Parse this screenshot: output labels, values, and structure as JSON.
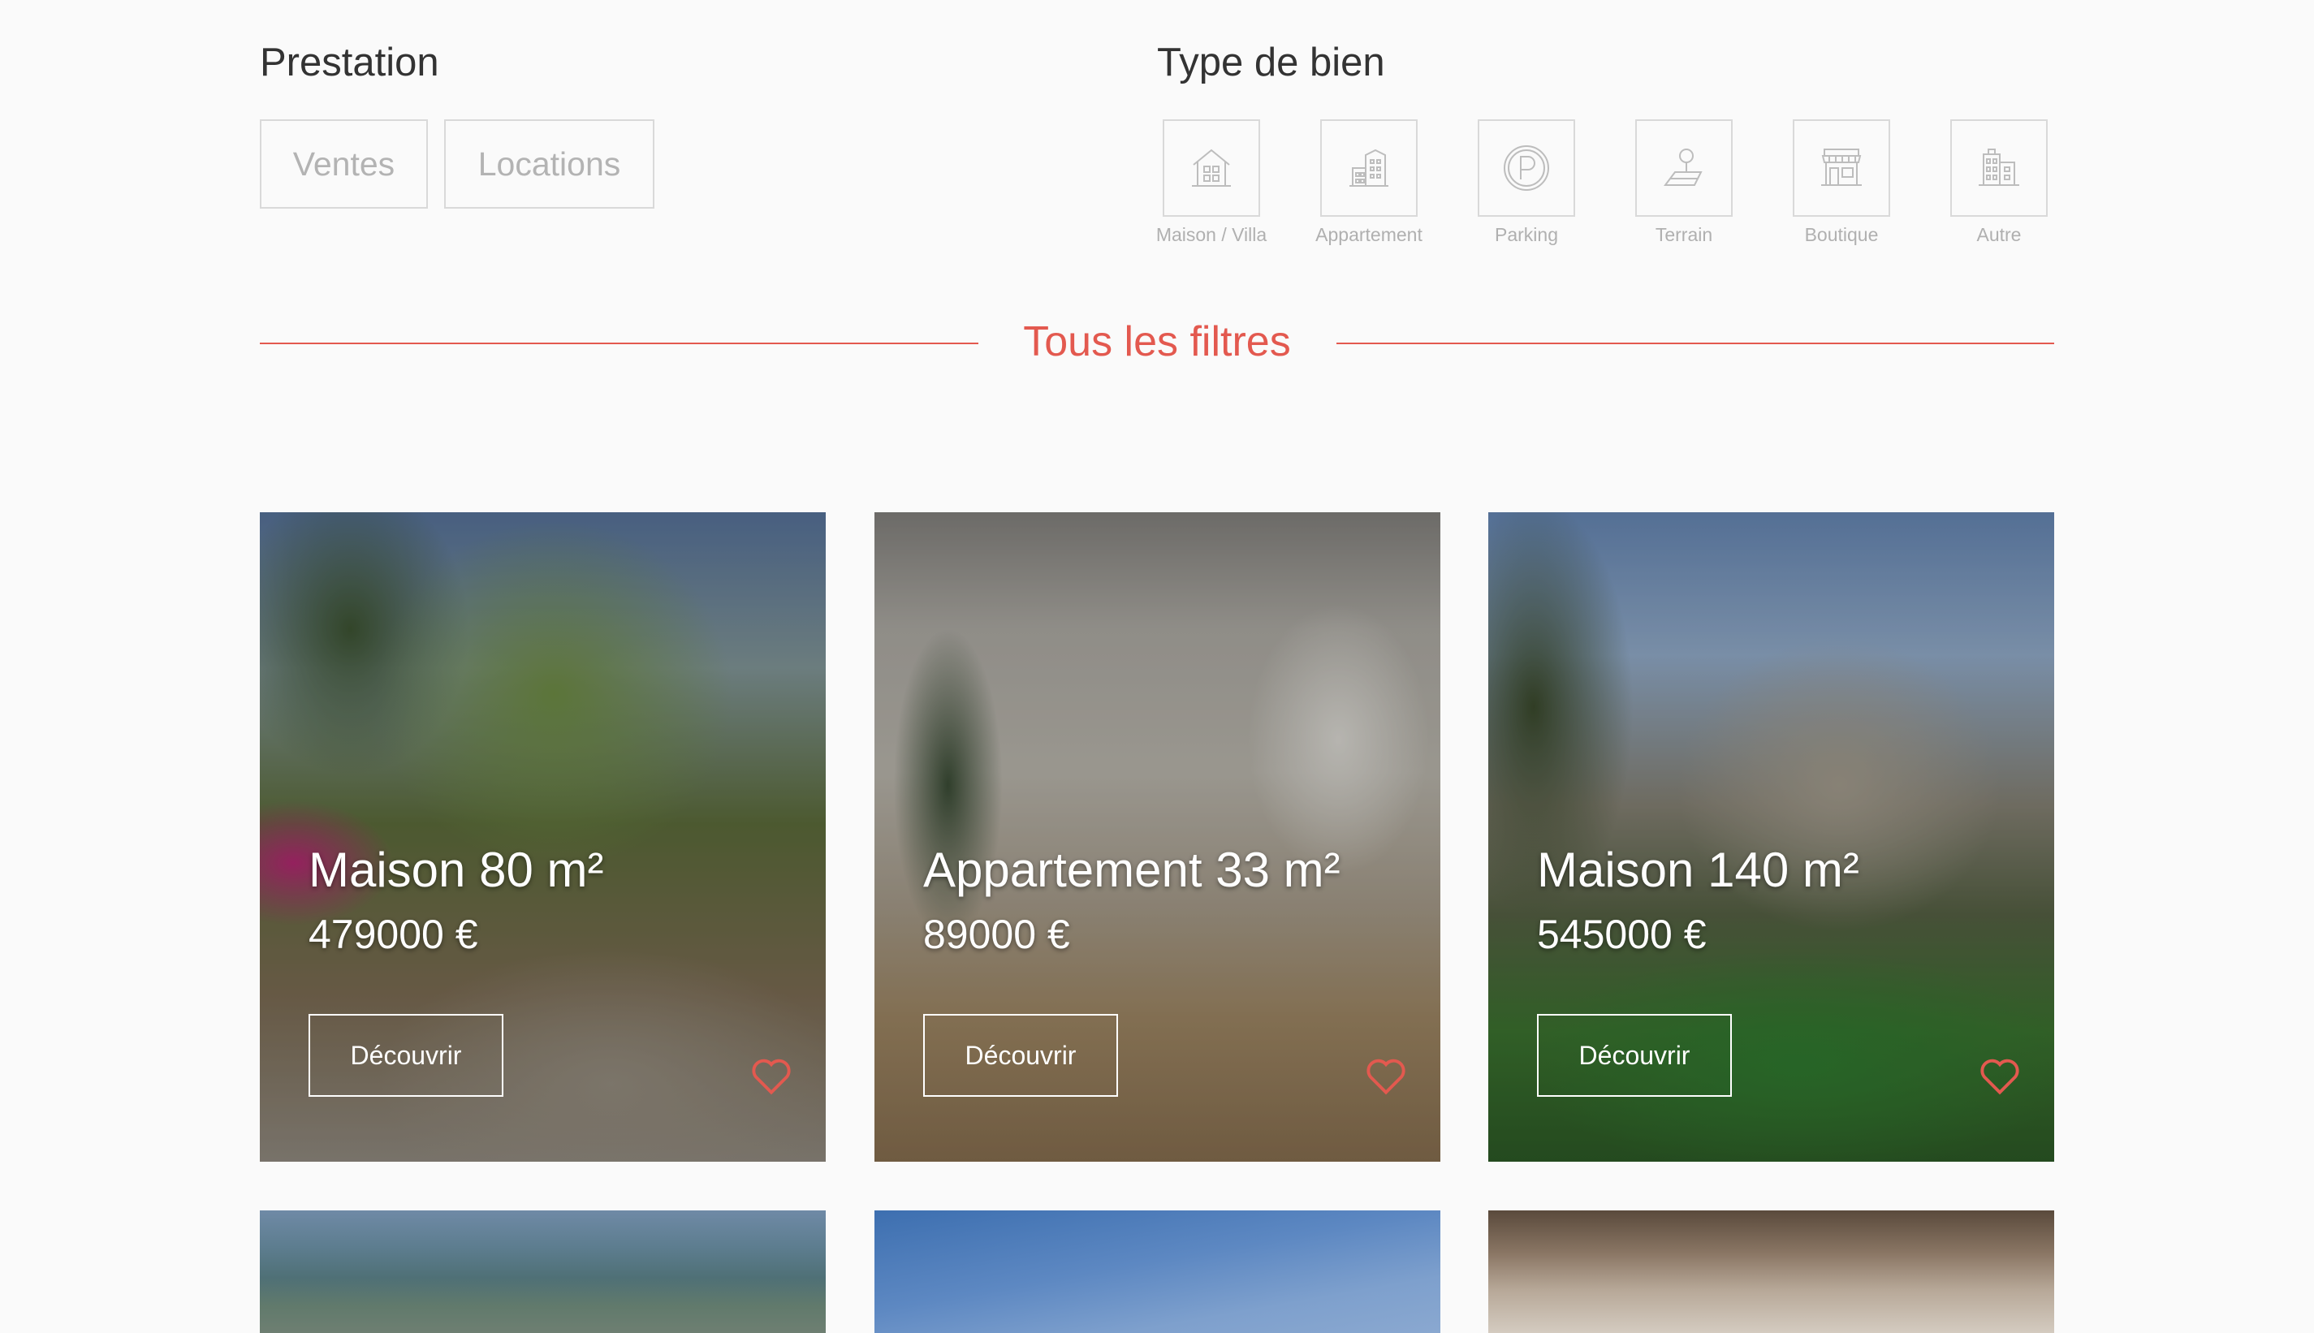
{
  "prestation": {
    "heading": "Prestation",
    "buttons": [
      {
        "label": "Ventes"
      },
      {
        "label": "Locations"
      }
    ]
  },
  "property_type": {
    "heading": "Type de bien",
    "tiles": [
      {
        "label": "Maison / Villa",
        "icon": "house-icon"
      },
      {
        "label": "Appartement",
        "icon": "apartment-building-icon"
      },
      {
        "label": "Parking",
        "icon": "parking-icon"
      },
      {
        "label": "Terrain",
        "icon": "land-icon"
      },
      {
        "label": "Boutique",
        "icon": "shop-icon"
      },
      {
        "label": "Autre",
        "icon": "other-building-icon"
      }
    ]
  },
  "all_filters": {
    "label": "Tous les filtres"
  },
  "listings": [
    {
      "title": "Maison 80 m²",
      "price": "479000 €",
      "cta": "Découvrir",
      "favorite_icon": "heart-icon"
    },
    {
      "title": "Appartement 33 m²",
      "price": "89000 €",
      "cta": "Découvrir",
      "favorite_icon": "heart-icon"
    },
    {
      "title": "Maison 140 m²",
      "price": "545000 €",
      "cta": "Découvrir",
      "favorite_icon": "heart-icon"
    }
  ],
  "colors": {
    "accent": "#e3594f",
    "border": "#d9d9d9",
    "muted_text": "#b3b3b3",
    "background": "#fafafa"
  }
}
